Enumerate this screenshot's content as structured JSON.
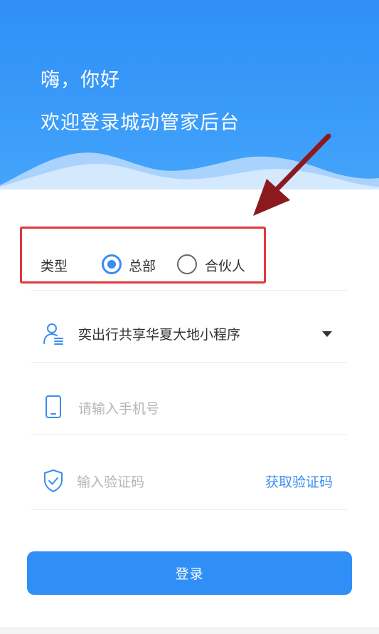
{
  "header": {
    "greeting": "嗨，你好",
    "welcome": "欢迎登录城动管家后台"
  },
  "type_selector": {
    "label": "类型",
    "options": [
      {
        "label": "总部",
        "selected": true
      },
      {
        "label": "合伙人",
        "selected": false
      }
    ]
  },
  "form": {
    "program_select": {
      "value": "奕出行共享华夏大地小程序",
      "icon": "user-list-icon"
    },
    "phone": {
      "placeholder": "请输入手机号",
      "icon": "phone-icon"
    },
    "verification": {
      "placeholder": "输入验证码",
      "icon": "shield-check-icon",
      "get_code_label": "获取验证码"
    }
  },
  "login_button": {
    "label": "登录"
  },
  "colors": {
    "primary": "#2f8ff7",
    "annotation": "#e0383b",
    "arrow": "#8b1a1e"
  }
}
